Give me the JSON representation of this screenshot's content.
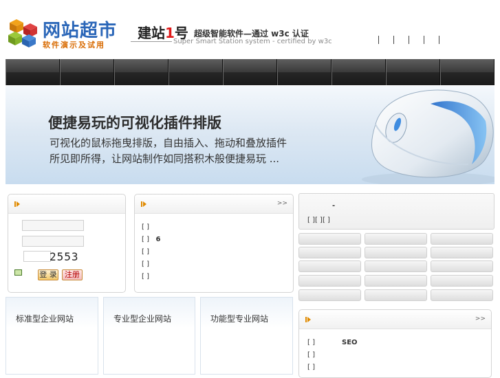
{
  "header": {
    "logo_name": "网站超市",
    "logo_sub": "软件演示及试用",
    "brand_prefix": "建站",
    "brand_number": "1",
    "brand_suffix": "号",
    "brand_tagline": "超级智能软件—通过 w3c 认证",
    "brand_en": "Super Smart Station system - certified by w3c"
  },
  "nav": {
    "items": [
      "",
      "",
      "",
      "",
      "",
      "",
      "",
      "",
      ""
    ]
  },
  "banner": {
    "headline": "便捷易玩的可视化插件排版",
    "line1": "可视化的鼠标拖曳排版，自由插入、拖动和叠放插件",
    "line2": "所见即所得，让网站制作如同搭积木般便捷易玩 ..."
  },
  "login": {
    "captcha": "2553",
    "login_label": "登 录",
    "register_label": "注册"
  },
  "news": {
    "more": ">>",
    "rows": [
      {
        "bracket": "[ ]",
        "text": ""
      },
      {
        "bracket": "[ ]",
        "text": "6"
      },
      {
        "bracket": "[ ]",
        "text": ""
      },
      {
        "bracket": "[ ]",
        "text": ""
      },
      {
        "bracket": "[ ]",
        "text": ""
      }
    ]
  },
  "info": {
    "dash": "-",
    "links": "[   ][   ][   ]"
  },
  "categories": [
    "标准型企业网站",
    "专业型企业网站",
    "功能型专业网站"
  ],
  "seo_panel": {
    "more": ">>",
    "rows": [
      {
        "bracket": "[ ]",
        "text": "SEO"
      },
      {
        "bracket": "[ ]",
        "text": ""
      },
      {
        "bracket": "[ ]",
        "text": ""
      }
    ]
  },
  "colors": {
    "accent": "#e08a00",
    "brand_blue": "#2a66b8",
    "brand_red": "#e01919"
  }
}
